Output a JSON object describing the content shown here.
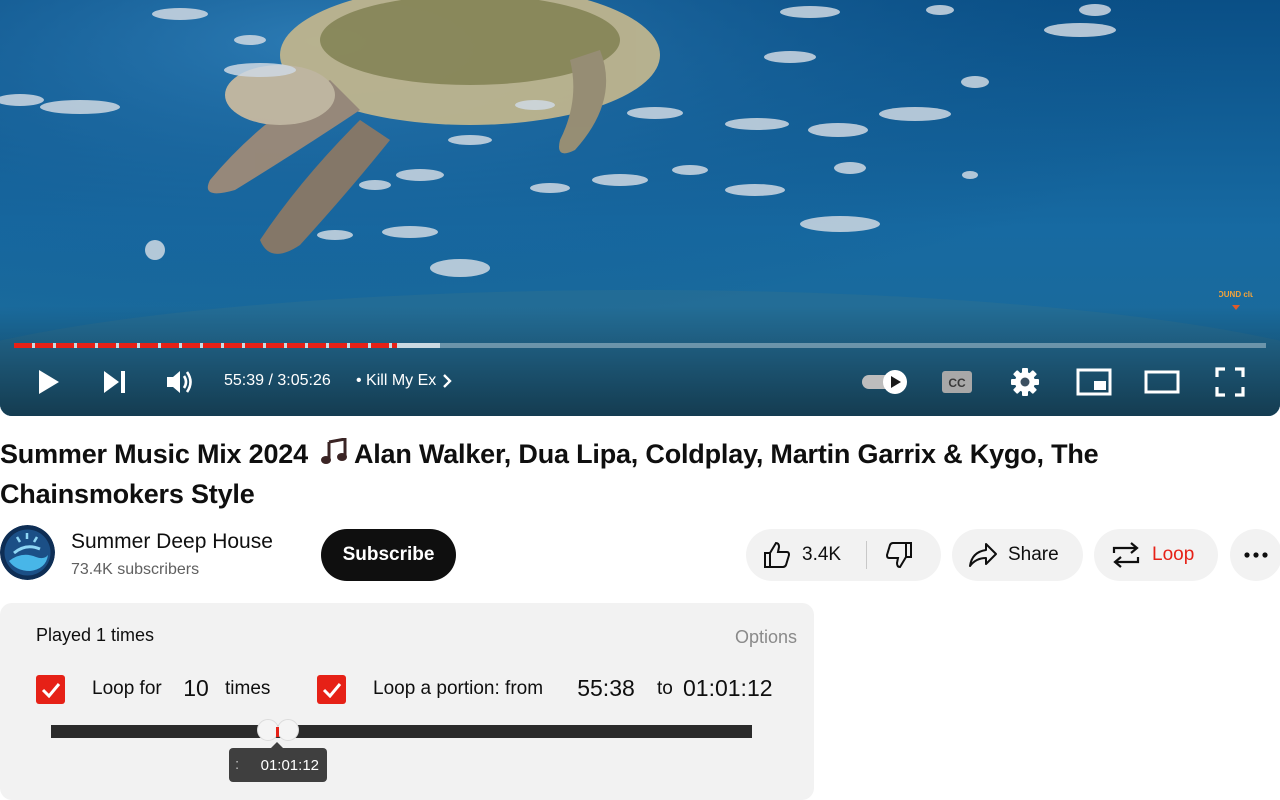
{
  "player": {
    "progress_fraction": 0.306,
    "buffer_fraction": 0.34,
    "current_time": "55:39",
    "duration": "3:05:26",
    "time_display": "55:39 / 3:05:26",
    "chapter": "•  Kill My Ex",
    "icons": [
      "play-icon",
      "next-icon",
      "volume-icon",
      "chevron-right-icon",
      "autoplay-toggle-icon",
      "captions-icon",
      "gear-icon",
      "miniplayer-icon",
      "theater-icon",
      "fullscreen-icon"
    ],
    "accent_color": "#e62117",
    "cc_label": "CC",
    "watermark": "SOUND club"
  },
  "video": {
    "title": "Summer Music Mix 2024",
    "title_rest": "Alan Walker, Dua Lipa, Coldplay, Martin Garrix & Kygo, The Chainsmokers Style",
    "title_icon": "music-note-icon"
  },
  "channel": {
    "name": "Summer Deep House",
    "subscribers": "73.4K subscribers",
    "subscribe_label": "Subscribe"
  },
  "actions": {
    "like_count": "3.4K",
    "share_label": "Share",
    "loop_label": "Loop",
    "icons": [
      "thumbs-up-icon",
      "thumbs-down-icon",
      "share-icon",
      "loop-icon",
      "more-icon"
    ]
  },
  "loop_panel": {
    "played_text": "Played 1 times",
    "options_label": "Options",
    "loop_for_label": "Loop for",
    "loop_times": "10",
    "times_label": "times",
    "loop_for_checked": true,
    "loop_portion_label": "Loop a portion: from",
    "from": "55:38",
    "to_label": "to",
    "to": "01:01:12",
    "loop_portion_checked": true,
    "range_start_fraction": 0.31,
    "range_end_fraction": 0.33,
    "tooltip": "01:01:12"
  }
}
